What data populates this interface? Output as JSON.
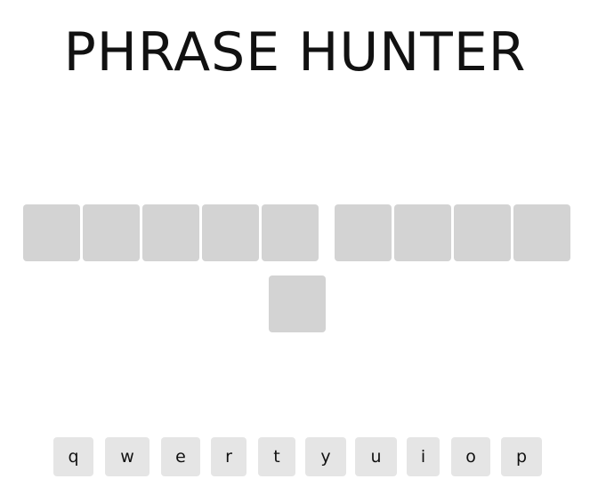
{
  "header": {
    "title": "PHRASE HUNTER"
  },
  "phrase": {
    "words": [
      5,
      4,
      1
    ],
    "revealed": []
  },
  "keyboard": {
    "row1": [
      "q",
      "w",
      "e",
      "r",
      "t",
      "y",
      "u",
      "i",
      "o",
      "p"
    ]
  },
  "colors": {
    "tile": "#d3d3d3",
    "key": "#e5e5e5"
  }
}
